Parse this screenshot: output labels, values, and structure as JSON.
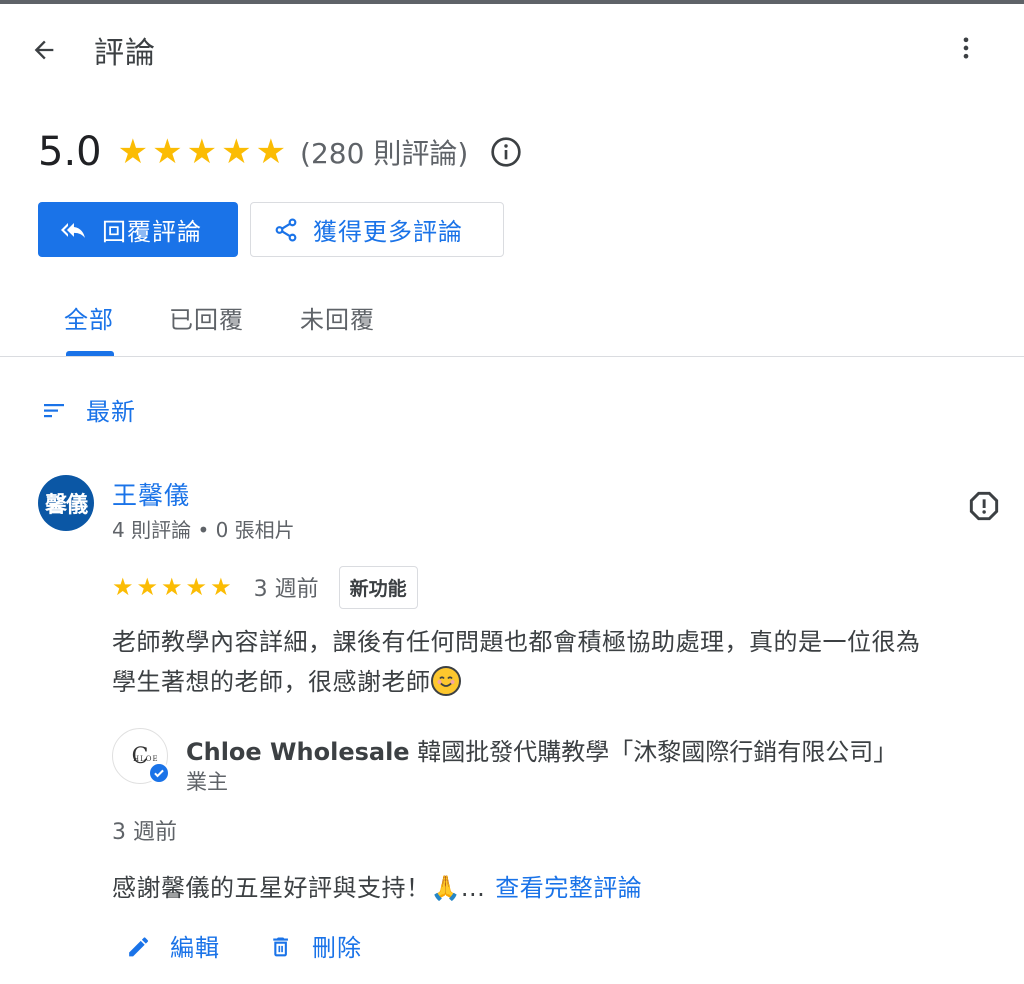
{
  "header": {
    "title": "評論",
    "back_icon": "arrow-left-icon",
    "menu_icon": "more-vertical-icon"
  },
  "summary": {
    "rating": "5.0",
    "stars": 5,
    "count_text": "(280 則評論)",
    "info_icon": "info-icon"
  },
  "actions": {
    "reply_label": "回覆評論",
    "get_more_label": "獲得更多評論"
  },
  "tabs": [
    {
      "label": "全部",
      "active": true
    },
    {
      "label": "已回覆",
      "active": false
    },
    {
      "label": "未回覆",
      "active": false
    }
  ],
  "sort": {
    "label": "最新",
    "icon": "sort-icon"
  },
  "review": {
    "avatar_text": "馨儀",
    "name": "王馨儀",
    "meta": "4 則評論 • 0 張相片",
    "stars": 5,
    "time": "3 週前",
    "badge": "新功能",
    "text_line1": "老師教學內容詳細，課後有任何問題也都會積極協助處理，真的是一位很為",
    "text_line2": "學生著想的老師，很感謝老師"
  },
  "owner_reply": {
    "logo_text": "C",
    "logo_sub": "HLOE",
    "name_bold": "Chloe Wholesale",
    "name_rest": " 韓國批發代購教學「沐黎國際行銷有限公司」",
    "role": "業主",
    "time": "3 週前",
    "text": "感謝馨儀的五星好評與支持！🙏...",
    "more_link": "查看完整評論",
    "edit_label": "編輯",
    "delete_label": "刪除"
  },
  "colors": {
    "accent": "#1a73e8",
    "star": "#fbbc04",
    "avatar_bg": "#0b57a5"
  }
}
